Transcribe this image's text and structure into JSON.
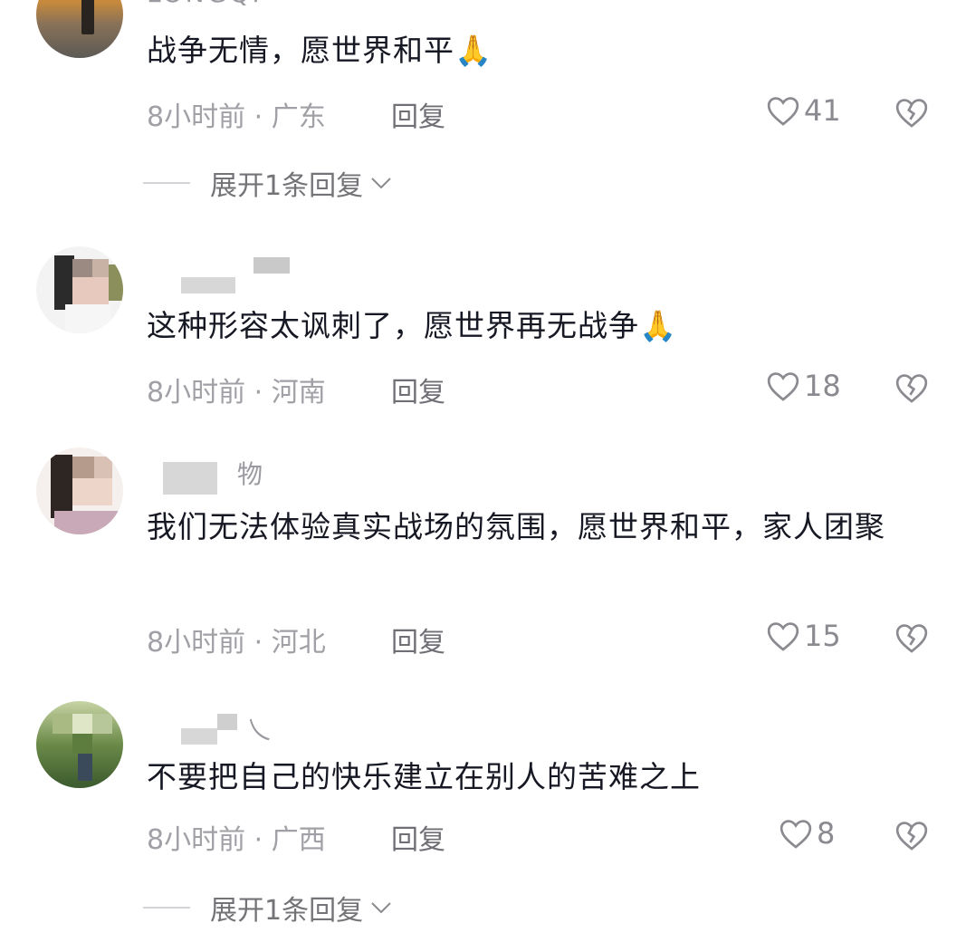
{
  "comments": [
    {
      "username": "LONGQI",
      "text": "战争无情，愿世界和平🙏",
      "time_location": "8小时前 · 广东",
      "reply_label": "回复",
      "likes": "41",
      "expand_label": "展开1条回复"
    },
    {
      "username": "",
      "text": "这种形容太讽刺了，愿世界再无战争🙏",
      "time_location": "8小时前 · 河南",
      "reply_label": "回复",
      "likes": "18"
    },
    {
      "username": "物",
      "text": "我们无法体验真实战场的氛围，愿世界和平，家人团聚",
      "time_location": "8小时前 · 河北",
      "reply_label": "回复",
      "likes": "15"
    },
    {
      "username": "乀",
      "text": "不要把自己的快乐建立在别人的苦难之上",
      "time_location": "8小时前 · 广西",
      "reply_label": "回复",
      "likes": "8",
      "expand_label": "展开1条回复"
    }
  ],
  "icons": {
    "like": "heart-outline-icon",
    "dislike": "broken-heart-icon",
    "expand": "chevron-down-icon"
  },
  "colors": {
    "text": "#161823",
    "meta": "#a0a0a6",
    "reply": "#6f6f75"
  }
}
